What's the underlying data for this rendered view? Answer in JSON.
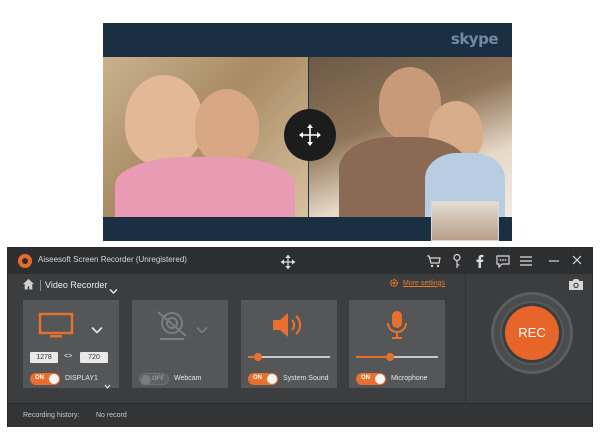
{
  "skype": {
    "logo_text": "skype",
    "move_icon": "move-arrows-icon"
  },
  "app": {
    "title": "Aiseesoft Screen Recorder (Unregistered)",
    "accent_color": "#e8702e"
  },
  "titlebar": {
    "icons": [
      "cart-icon",
      "key-icon",
      "facebook-icon",
      "chat-icon",
      "menu-icon"
    ],
    "window_buttons": [
      "minimize-icon",
      "close-icon"
    ]
  },
  "subheader": {
    "mode_label": "Video Recorder",
    "more_settings_label": "More settings"
  },
  "display": {
    "width": "1278",
    "link": "<>",
    "height": "720",
    "toggle": "ON",
    "label": "DISPLAY1"
  },
  "webcam": {
    "toggle": "OFF",
    "label": "Webcam"
  },
  "system_sound": {
    "toggle": "ON",
    "label": "System Sound",
    "volume": 0.12
  },
  "microphone": {
    "toggle": "ON",
    "label": "Microphone",
    "volume": 0.42
  },
  "rec_button": {
    "label": "REC"
  },
  "status": {
    "history_label": "Recording history:",
    "history_value": "No record"
  }
}
